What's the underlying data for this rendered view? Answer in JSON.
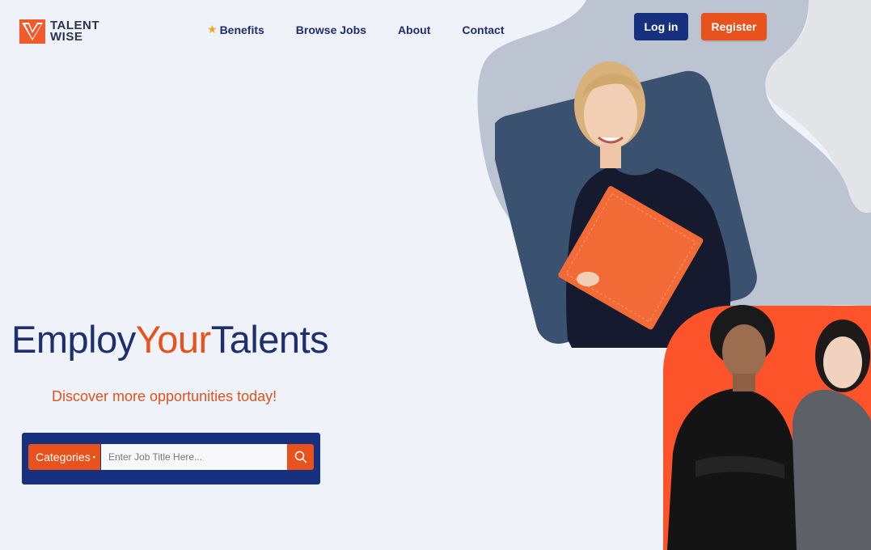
{
  "brand": {
    "line1": "TALENT",
    "line2": "WISE",
    "logo_icon": "v-chevron-logo-icon",
    "color_primary": "#17317e",
    "color_accent": "#e8521c"
  },
  "nav": {
    "items": [
      {
        "label": "Benefits",
        "icon": "star-icon"
      },
      {
        "label": "Browse Jobs"
      },
      {
        "label": "About"
      },
      {
        "label": "Contact"
      }
    ]
  },
  "auth": {
    "login_label": "Log in",
    "register_label": "Register"
  },
  "hero": {
    "title_part1": "Employ",
    "title_part2": "Your",
    "title_part3": "Talents",
    "subtitle": "Discover more opportunities today!"
  },
  "search": {
    "categories_label": "Categories",
    "placeholder": "Enter Job Title Here...",
    "search_icon": "search-icon"
  },
  "images": {
    "hero_photo_1": "woman-holding-orange-folder-photo",
    "hero_photo_2": "two-people-arms-crossed-photo"
  }
}
